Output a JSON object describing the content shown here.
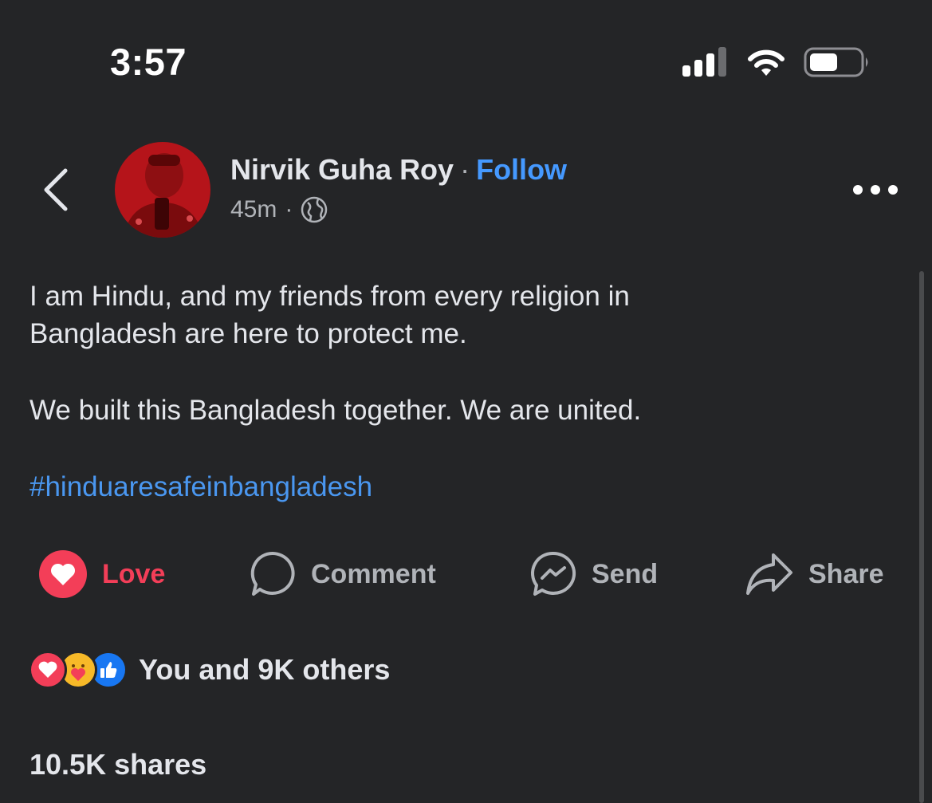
{
  "status_bar": {
    "time": "3:57"
  },
  "header": {
    "author_name": "Nirvik Guha Roy",
    "name_separator": "·",
    "follow_label": "Follow",
    "timestamp": "45m",
    "meta_separator": "·",
    "privacy_icon": "globe-icon"
  },
  "post": {
    "paragraph_1": "I am Hindu, and my friends from every religion in Bangladesh are here to protect me.",
    "paragraph_2": "We built this Bangladesh together. We are united.",
    "hashtag": "#hinduaresafeinbangladesh"
  },
  "actions": {
    "love_label": "Love",
    "comment_label": "Comment",
    "send_label": "Send",
    "share_label": "Share"
  },
  "reactions": {
    "icons": [
      "heart-icon",
      "care-icon",
      "like-icon"
    ],
    "summary": "You and 9K others"
  },
  "shares": {
    "label": "10.5K shares"
  },
  "colors": {
    "background": "#242527",
    "accent_blue": "#4599ff",
    "love_red": "#f33e58",
    "muted": "#b0b3b8"
  }
}
